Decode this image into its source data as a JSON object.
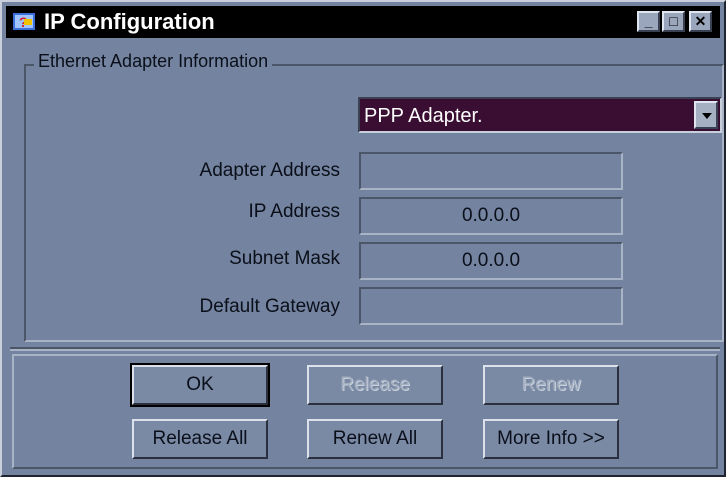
{
  "window": {
    "title": "IP Configuration",
    "minimize_label": "_",
    "maximize_label": "□",
    "close_label": "✕"
  },
  "group": {
    "legend": "Ethernet  Adapter Information"
  },
  "adapter_select": {
    "selected": "PPP Adapter."
  },
  "fields": {
    "adapter_address": {
      "label": "Adapter Address",
      "value": ""
    },
    "ip_address": {
      "label": "IP Address",
      "value": "0.0.0.0"
    },
    "subnet_mask": {
      "label": "Subnet Mask",
      "value": "0.0.0.0"
    },
    "default_gateway": {
      "label": "Default Gateway",
      "value": ""
    }
  },
  "buttons": {
    "ok": "OK",
    "release": "Release",
    "renew": "Renew",
    "release_all": "Release All",
    "renew_all": "Renew All",
    "more_info": "More Info >>"
  },
  "colors": {
    "title_bar": "#000000",
    "selection": "#3a0d32",
    "face": "#74839f"
  }
}
